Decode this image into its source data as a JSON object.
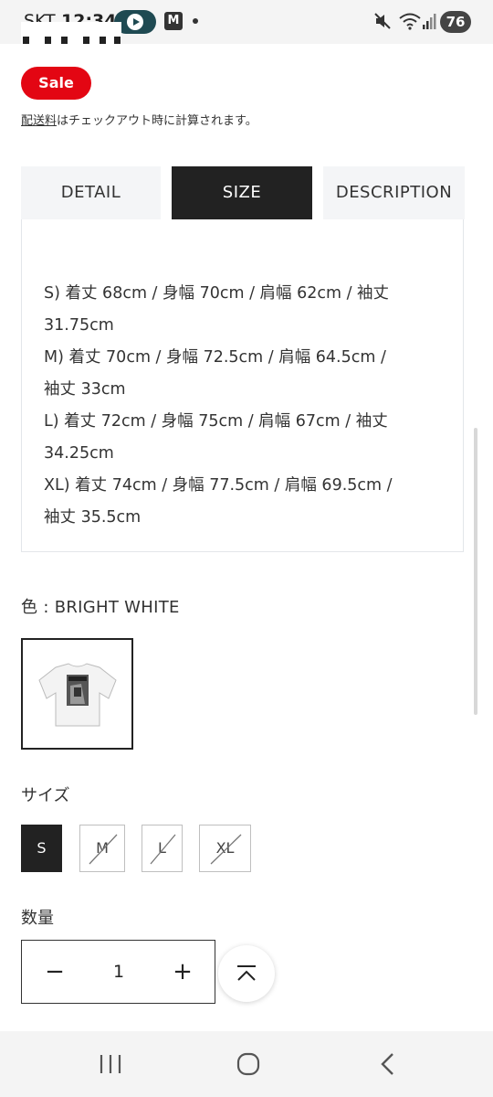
{
  "status_bar": {
    "carrier": "SKT",
    "time": "12:34",
    "notification_badge": "M",
    "battery": "76",
    "icons": [
      "play-icon",
      "m-app-icon",
      "dot-icon",
      "mute-icon",
      "wifi-icon",
      "signal-icon",
      "battery-icon"
    ]
  },
  "product": {
    "sale_badge": "Sale",
    "shipping_link": "配送料",
    "shipping_text": "はチェックアウト時に計算されます。"
  },
  "tabs": [
    {
      "label": "DETAIL",
      "active": false
    },
    {
      "label": "SIZE",
      "active": true
    },
    {
      "label": "DESCRIPTION",
      "active": false
    }
  ],
  "size_panel": {
    "lines": [
      "S) 着丈 68cm / 身幅 70cm / 肩幅 62cm / 袖丈",
      "31.75cm",
      "M) 着丈 70cm / 身幅 72.5cm / 肩幅 64.5cm /",
      "袖丈 33cm",
      "L) 着丈 72cm / 身幅 75cm / 肩幅 67cm / 袖丈",
      "34.25cm",
      "XL) 着丈 74cm / 身幅 77.5cm / 肩幅 69.5cm /",
      "袖丈 35.5cm"
    ]
  },
  "color": {
    "label": "色 : BRIGHT WHITE",
    "swatch_icon": "white-tshirt-thumbnail"
  },
  "size_selector": {
    "label": "サイズ",
    "options": [
      {
        "label": "S",
        "selected": true,
        "available": true
      },
      {
        "label": "M",
        "selected": false,
        "available": false
      },
      {
        "label": "L",
        "selected": false,
        "available": false
      },
      {
        "label": "XL",
        "selected": false,
        "available": false
      }
    ]
  },
  "quantity": {
    "label": "数量",
    "minus": "−",
    "value": "1",
    "plus": "+"
  },
  "back_to_top_icon": "chevron-up-icon",
  "nav_bar": {
    "icons": [
      "recents-icon",
      "home-icon",
      "back-icon"
    ]
  },
  "colors": {
    "sale_red": "#e30613",
    "active_tab": "#222222",
    "inactive_tab": "#f4f5f7"
  }
}
